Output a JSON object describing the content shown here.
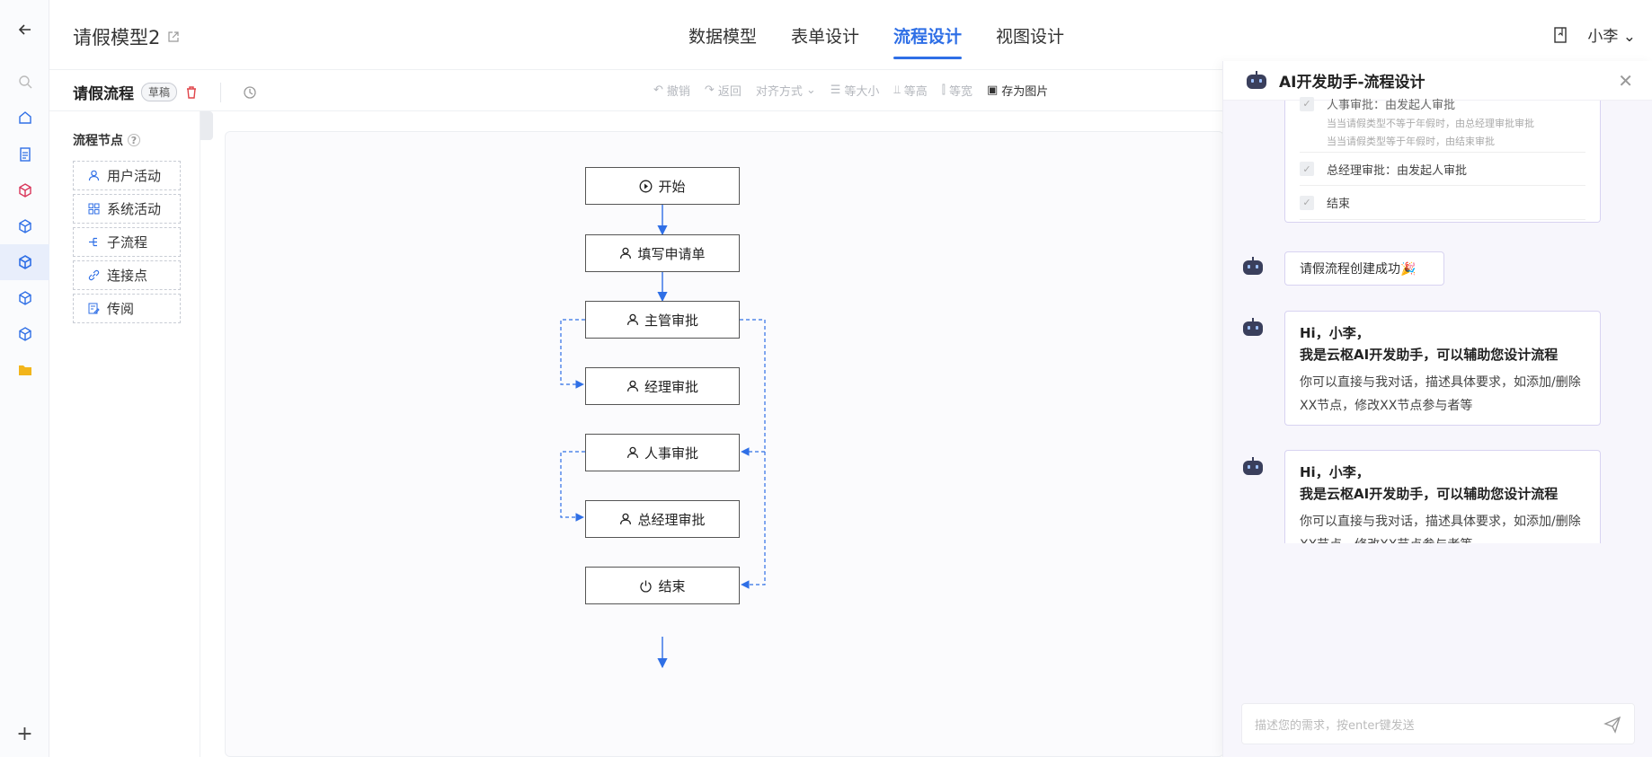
{
  "header": {
    "model_title": "请假模型2",
    "tabs": [
      {
        "label": "数据模型"
      },
      {
        "label": "表单设计"
      },
      {
        "label": "流程设计"
      },
      {
        "label": "视图设计"
      }
    ],
    "user": "小李"
  },
  "toolbar": {
    "flow_name": "请假流程",
    "status_badge": "草稿",
    "undo": "撤销",
    "redo": "返回",
    "align": "对齐方式",
    "same_size": "等大小",
    "same_height": "等高",
    "same_width": "等宽",
    "save_image": "存为图片"
  },
  "palette": {
    "title": "流程节点",
    "items": [
      {
        "label": "用户活动",
        "icon": "user-icon"
      },
      {
        "label": "系统活动",
        "icon": "grid-icon"
      },
      {
        "label": "子流程",
        "icon": "subflow-icon"
      },
      {
        "label": "连接点",
        "icon": "link-icon"
      },
      {
        "label": "传阅",
        "icon": "edit-doc-icon"
      }
    ]
  },
  "flow": {
    "nodes": [
      {
        "label": "开始",
        "icon": "play-icon"
      },
      {
        "label": "填写申请单",
        "icon": "user-icon"
      },
      {
        "label": "主管审批",
        "icon": "user-icon"
      },
      {
        "label": "经理审批",
        "icon": "user-icon"
      },
      {
        "label": "人事审批",
        "icon": "user-icon"
      },
      {
        "label": "总经理审批",
        "icon": "user-icon"
      },
      {
        "label": "结束",
        "icon": "power-icon"
      }
    ]
  },
  "ai_panel": {
    "title": "AI开发助手-流程设计",
    "steps": [
      {
        "label": "人事审批：由发起人审批",
        "sub": [
          "当当请假类型不等于年假时，由总经理审批审批",
          "当当请假类型等于年假时，由结束审批"
        ]
      },
      {
        "label": "总经理审批：由发起人审批"
      },
      {
        "label": "结束"
      }
    ],
    "success_msg": "请假流程创建成功🎉",
    "greeting_1": "Hi，小李，",
    "greeting_2": "我是云枢AI开发助手，可以辅助您设计流程",
    "greeting_desc": "你可以直接与我对话，描述具体要求，如添加/删除XX节点，修改XX节点参与者等",
    "greeting_desc_partial": "你可以直接与我对话，描述具体要求，如添加/删除XX节点，修改XX节点参与者等",
    "input_placeholder": "描述您的需求，按enter键发送"
  }
}
